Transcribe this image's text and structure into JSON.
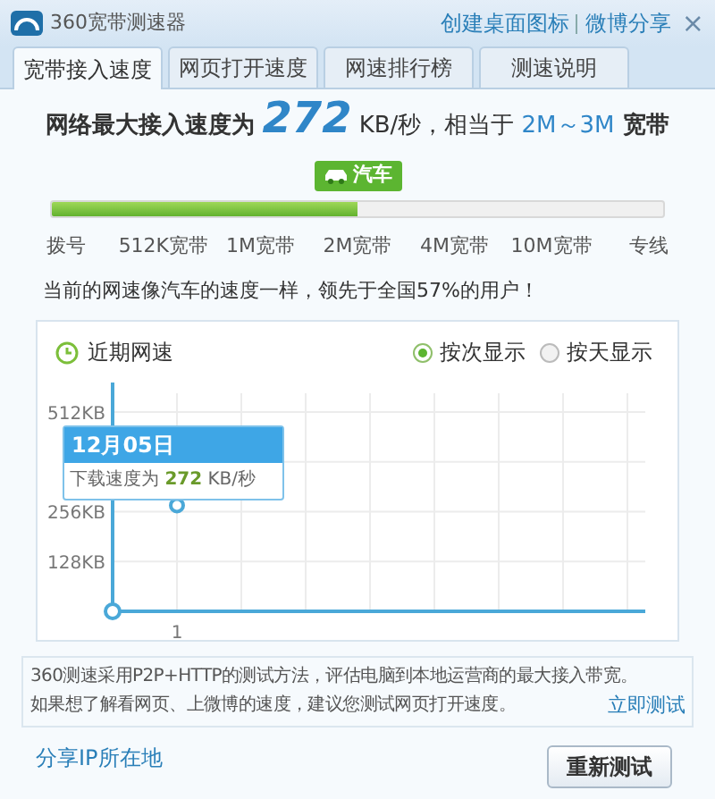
{
  "window": {
    "title": "360宽带测速器",
    "links": [
      "创建桌面图标",
      "微博分享"
    ],
    "close": "×"
  },
  "tabs": [
    {
      "label": "宽带接入速度",
      "selected": true
    },
    {
      "label": "网页打开速度",
      "selected": false
    },
    {
      "label": "网速排行榜",
      "selected": false
    },
    {
      "label": "测速说明",
      "selected": false
    }
  ],
  "result": {
    "prefix": "网络最大接入速度为",
    "speed": "272",
    "unit": "KB/秒，相当于",
    "bandwidth": "2M～3M",
    "suffix": "宽带"
  },
  "badge": {
    "label": "汽车"
  },
  "meter": {
    "level": 0.5,
    "marks": [
      "拨号",
      "512K宽带",
      "1M宽带",
      "2M宽带",
      "4M宽带",
      "10M宽带",
      "专线"
    ]
  },
  "summary": "当前的网速像汽车的速度一样，领先于全国57%的用户！",
  "recent": {
    "title": "近期网速",
    "options": [
      {
        "label": "按次显示",
        "selected": true
      },
      {
        "label": "按天显示",
        "selected": false
      }
    ],
    "tooltip": {
      "date": "12月05日",
      "prefix": "下载速度为",
      "value": "272",
      "unit": "KB/秒"
    },
    "chart_data": {
      "type": "line",
      "categories": [
        "1"
      ],
      "grid": true,
      "series": [
        {
          "color": "#4aa8d8",
          "marker": true,
          "values": [
            272
          ]
        }
      ],
      "ylim": [
        0,
        560
      ],
      "yticks": [
        {
          "value": 128,
          "label": "128KB"
        },
        {
          "value": 256,
          "label": "256KB"
        },
        {
          "value": 512,
          "label": "512KB"
        }
      ]
    }
  },
  "info": {
    "lines": [
      "360测速采用P2P+HTTP的测试方法，评估电脑到本地运营商的最大接入带宽。",
      "如果想了解看网页、上微博的速度，建议您测试网页打开速度。"
    ],
    "link": "立即测试"
  },
  "footer": {
    "link": "分享IP所在地",
    "button": "重新测试"
  }
}
